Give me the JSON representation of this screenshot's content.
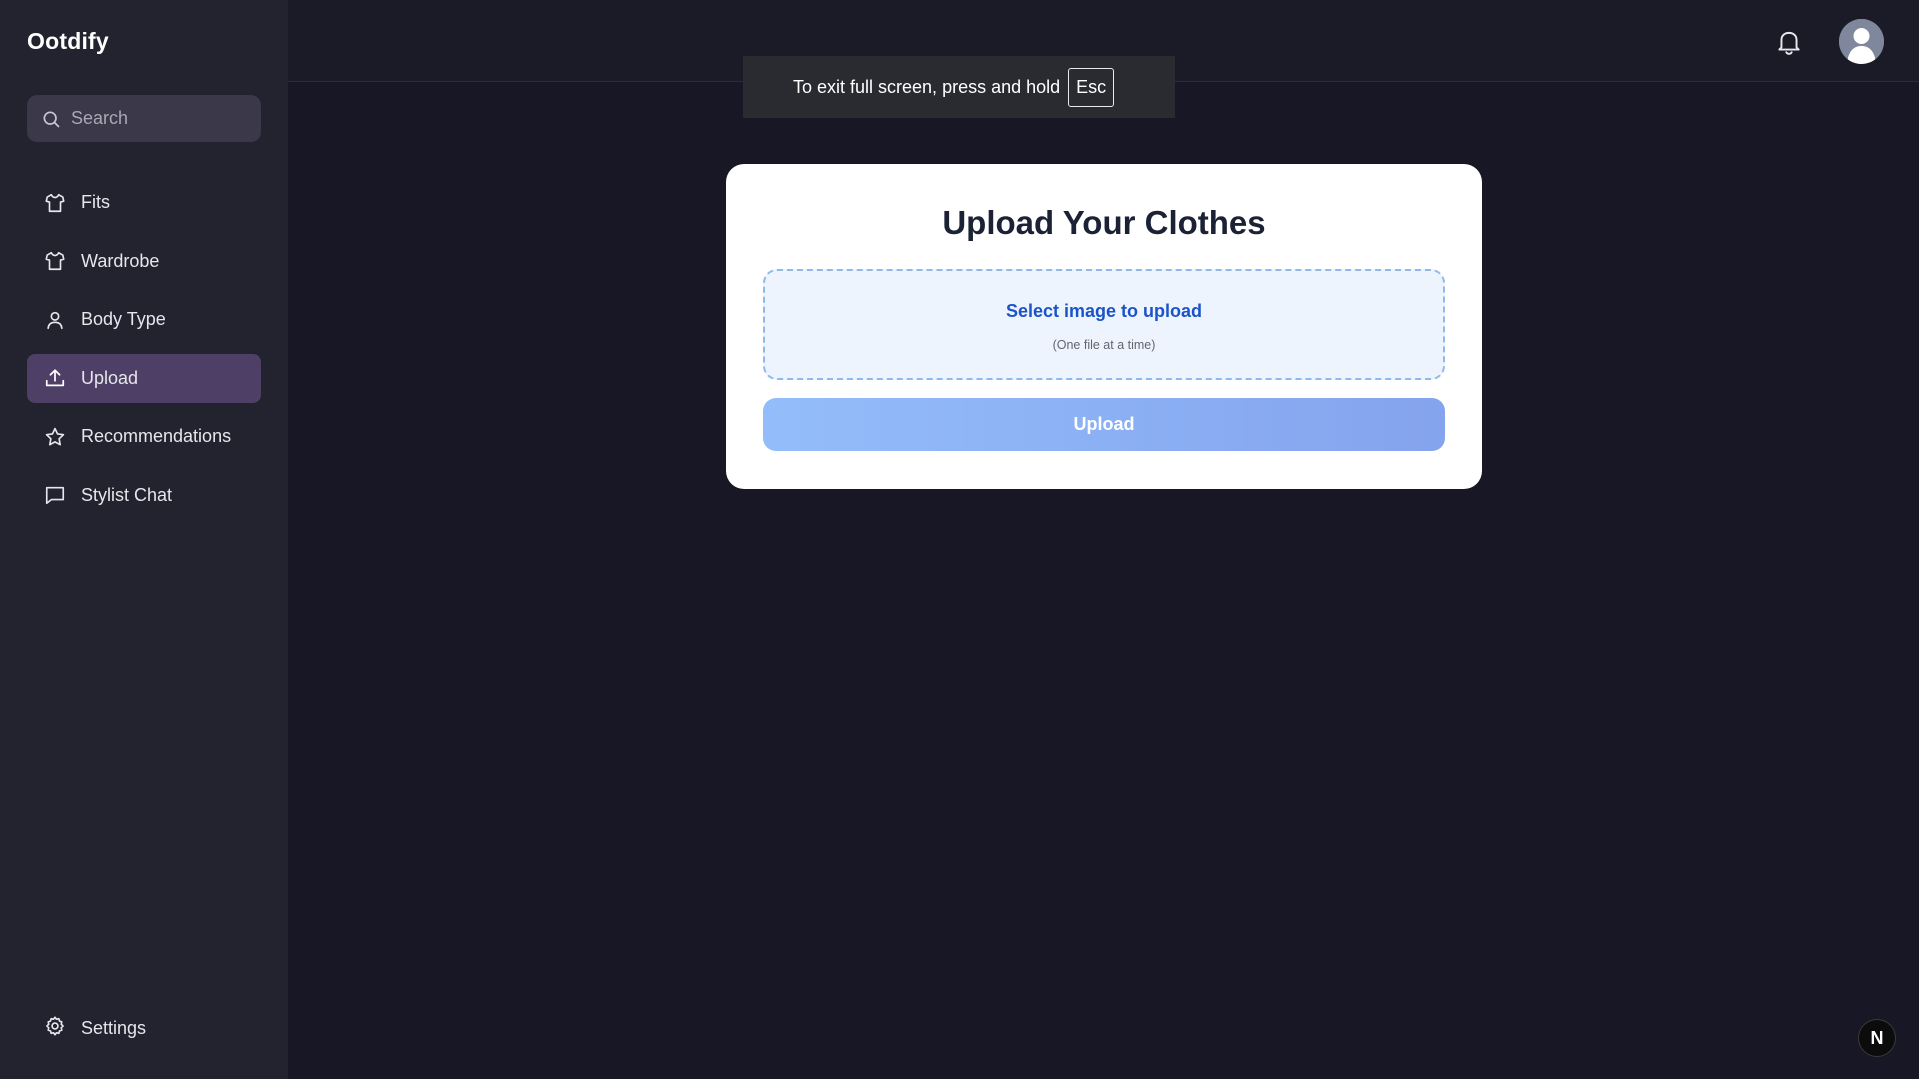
{
  "brand": {
    "name": "Ootdify"
  },
  "search": {
    "placeholder": "Search",
    "value": ""
  },
  "nav": {
    "items": [
      {
        "label": "Fits",
        "icon": "shirt-icon",
        "active": false
      },
      {
        "label": "Wardrobe",
        "icon": "shirt-icon",
        "active": false
      },
      {
        "label": "Body Type",
        "icon": "user-icon",
        "active": false
      },
      {
        "label": "Upload",
        "icon": "upload-icon",
        "active": true
      },
      {
        "label": "Recommendations",
        "icon": "star-icon",
        "active": false
      },
      {
        "label": "Stylist Chat",
        "icon": "chat-icon",
        "active": false
      }
    ],
    "settings_label": "Settings"
  },
  "header": {
    "notification_icon": "bell-icon",
    "avatar_icon": "avatar-icon"
  },
  "fullscreen_toast": {
    "text": "To exit full screen, press and hold",
    "key": "Esc"
  },
  "upload_card": {
    "title": "Upload Your Clothes",
    "dropzone_label": "Select image to upload",
    "dropzone_hint": "(One file at a time)",
    "button_label": "Upload"
  },
  "dev_badge": {
    "label": "N"
  },
  "colors": {
    "sidebar_bg": "#23222f",
    "main_bg": "#171725",
    "active_nav_bg": "#4e3f66",
    "accent_blue": "#1b53c9",
    "button_gradient_start": "#93bdfa",
    "button_gradient_end": "#85a3ee"
  }
}
